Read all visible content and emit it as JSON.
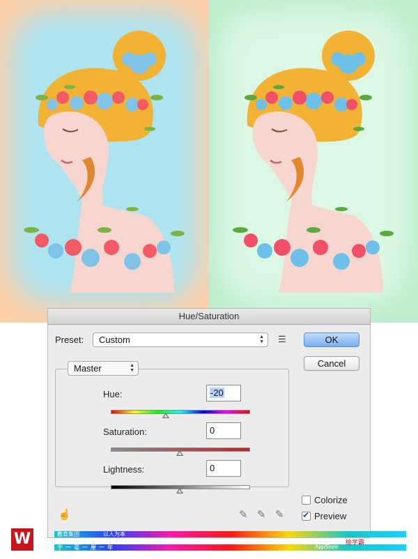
{
  "dialog": {
    "title": "Hue/Saturation",
    "preset_label": "Preset:",
    "preset_value": "Custom",
    "channel_value": "Master",
    "ok_label": "OK",
    "cancel_label": "Cancel",
    "hue_label": "Hue:",
    "hue_value": "-20",
    "hue_position": 0.4,
    "saturation_label": "Saturation:",
    "saturation_value": "0",
    "saturation_position": 0.5,
    "lightness_label": "Lightness:",
    "lightness_value": "0",
    "lightness_position": 0.5,
    "colorize_label": "Colorize",
    "colorize_checked": false,
    "preview_label": "Preview",
    "preview_checked": true
  },
  "colors": {
    "left_background": "#fcd0a8",
    "left_glow": "#aee4f0",
    "right_background": "#bdeecd",
    "hair": "#f2b233",
    "skin": "#f6d6cf",
    "ok_button": "#76aef0",
    "logo_red": "#c8161d"
  },
  "icons": [
    "hand-scrubby-icon",
    "eyedropper-icon",
    "eyedropper-plus-icon",
    "eyedropper-minus-icon",
    "preset-menu-icon"
  ],
  "watermark": {
    "logo_letter": "W",
    "line1_left": "教育集团",
    "line1_tagline": "以人为本",
    "line2_left": "于一毫一厘一年",
    "right_brand": "绘学霸",
    "right_sub": "AppStore"
  }
}
